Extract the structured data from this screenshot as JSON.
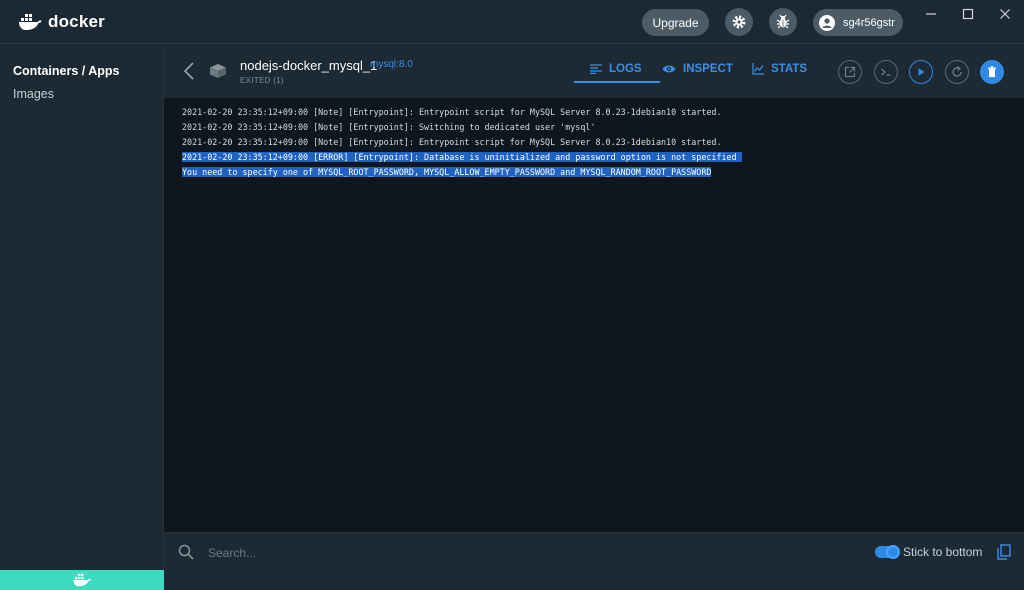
{
  "app": {
    "name": "docker"
  },
  "titlebar": {
    "upgrade_label": "Upgrade",
    "username": "sg4r56gstr"
  },
  "sidebar": {
    "items": [
      {
        "label": "Containers / Apps",
        "active": true
      },
      {
        "label": "Images",
        "active": false
      }
    ]
  },
  "container": {
    "name": "nodejs-docker_mysql_1",
    "image": "mysql:8.0",
    "status": "EXITED (1)"
  },
  "tabs": [
    {
      "label": "LOGS",
      "icon": "logs-icon",
      "active": true
    },
    {
      "label": "INSPECT",
      "icon": "eye-icon",
      "active": false
    },
    {
      "label": "STATS",
      "icon": "stats-icon",
      "active": false
    }
  ],
  "actions": [
    "open-browser-icon",
    "cli-icon",
    "start-icon",
    "restart-icon",
    "delete-icon"
  ],
  "logs": [
    {
      "text": "2021-02-20 23:35:12+09:00 [Note] [Entrypoint]: Entrypoint script for MySQL Server 8.0.23-1debian10 started.",
      "selected": false
    },
    {
      "text": "2021-02-20 23:35:12+09:00 [Note] [Entrypoint]: Switching to dedicated user 'mysql'",
      "selected": false
    },
    {
      "text": "2021-02-20 23:35:12+09:00 [Note] [Entrypoint]: Entrypoint script for MySQL Server 8.0.23-1debian10 started.",
      "selected": false
    },
    {
      "text": "2021-02-20 23:35:12+09:00 [ERROR] [Entrypoint]: Database is uninitialized and password option is not specified ",
      "selected": true
    },
    {
      "text": "You need to specify one of MYSQL_ROOT_PASSWORD, MYSQL_ALLOW_EMPTY_PASSWORD and MYSQL_RANDOM_ROOT_PASSWORD",
      "selected": true
    }
  ],
  "footer": {
    "search_placeholder": "Search...",
    "stick_label": "Stick to bottom",
    "stick_enabled": true
  },
  "colors": {
    "accent": "#2f8ae6",
    "whale_bar": "#3ddcc0",
    "selection": "#1f62c4"
  }
}
